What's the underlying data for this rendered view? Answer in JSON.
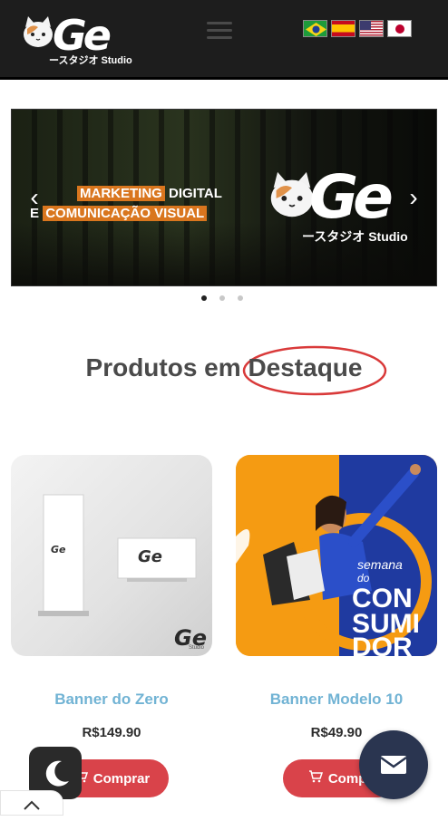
{
  "header": {
    "logo_text": "Ge",
    "logo_sub": "ースタジオ Studio",
    "menu_icon": "hamburger-icon",
    "flags": [
      "flag-brazil",
      "flag-spain",
      "flag-usa",
      "flag-japan"
    ]
  },
  "banner": {
    "line1_highlight": "MARKETING",
    "line1_rest": " DIGITAL",
    "line2_prefix": "E ",
    "line2_highlight": "COMUNICAÇÃO VISUAL",
    "logo_text": "Ge",
    "logo_sub": "ースタジオ Studio",
    "prev_icon": "chevron-left-icon",
    "next_icon": "chevron-right-icon",
    "slide_count": 3,
    "active_slide": 1
  },
  "section": {
    "title_prefix": "Produtos em ",
    "title_circled": "Destaque"
  },
  "products": [
    {
      "name": "Banner do Zero",
      "price": "R$149.90",
      "buy_label": "Comprar"
    },
    {
      "name": "Banner Modelo 10",
      "price": "R$49.90",
      "buy_label": "Compr",
      "image_text": {
        "semana": "semana",
        "do": "do",
        "consumidor_1": "CON",
        "consumidor_2": "SUMI",
        "consumidor_3": "DOR"
      }
    }
  ],
  "mockup_logo_text": "Ge",
  "mockup_logo_sub": "Studio",
  "colors": {
    "header_bg": "#1d1d1d",
    "accent_orange": "#d9761e",
    "product_name": "#71b3d4",
    "buy_button": "#d9434a",
    "mail_fab": "#2a3550",
    "circle_red": "#d93a3a"
  },
  "floating": {
    "dark_mode_icon": "moon-icon",
    "mail_icon": "mail-icon",
    "scroll_up_icon": "chevron-up-icon"
  }
}
